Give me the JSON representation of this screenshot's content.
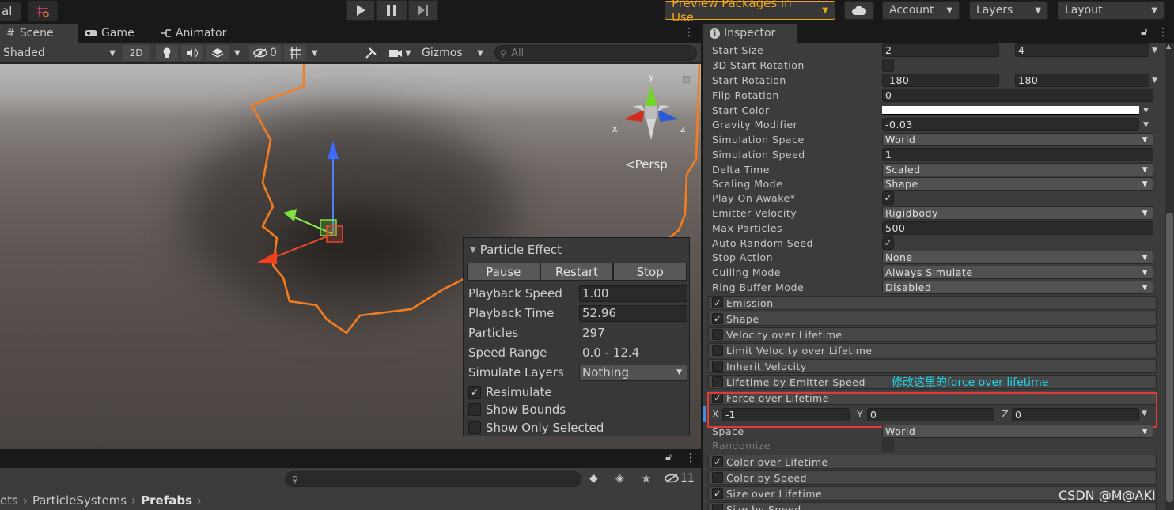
{
  "toolbar": {
    "left_label": "al",
    "preview_packages": "Preview Packages in Use",
    "account": "Account",
    "layers": "Layers",
    "layout": "Layout"
  },
  "scene_tabs": [
    {
      "label": "Scene",
      "icon": "grid-icon"
    },
    {
      "label": "Game",
      "icon": "gamepad-icon"
    },
    {
      "label": "Animator",
      "icon": "animator-icon"
    }
  ],
  "scene_bar": {
    "shading": "Shaded",
    "mode2d": "2D",
    "hidden_count": "0",
    "gizmos": "Gizmos",
    "search_placeholder": "All"
  },
  "gizmo": {
    "x": "x",
    "y": "y",
    "z": "z",
    "persp": "Persp"
  },
  "particle_effect": {
    "title": "Particle Effect",
    "buttons": [
      "Pause",
      "Restart",
      "Stop"
    ],
    "playback_speed_label": "Playback Speed",
    "playback_speed": "1.00",
    "playback_time_label": "Playback Time",
    "playback_time": "52.96",
    "particles_label": "Particles",
    "particles": "297",
    "speed_range_label": "Speed Range",
    "speed_range": "0.0 - 12.4",
    "simulate_layers_label": "Simulate Layers",
    "simulate_layers": "Nothing",
    "resimulate": "Resimulate",
    "show_bounds": "Show Bounds",
    "show_only_selected": "Show Only Selected"
  },
  "bottom": {
    "count": "11",
    "breadcrumb": [
      "ets",
      "ParticleSystems",
      "Prefabs"
    ]
  },
  "inspector": {
    "title": "Inspector",
    "rows": [
      {
        "label": "Start Size",
        "type": "range",
        "v1": "2",
        "v2": "4"
      },
      {
        "label": "3D Start Rotation",
        "type": "check",
        "checked": false
      },
      {
        "label": "Start Rotation",
        "type": "range",
        "v1": "-180",
        "v2": "180"
      },
      {
        "label": "Flip Rotation",
        "type": "field",
        "value": "0"
      },
      {
        "label": "Start Color",
        "type": "color"
      },
      {
        "label": "Gravity Modifier",
        "type": "fieldarrow",
        "value": "-0.03"
      },
      {
        "label": "Simulation Space",
        "type": "dropdown",
        "value": "World"
      },
      {
        "label": "Simulation Speed",
        "type": "field",
        "value": "1"
      },
      {
        "label": "Delta Time",
        "type": "dropdown",
        "value": "Scaled"
      },
      {
        "label": "Scaling Mode",
        "type": "dropdown",
        "value": "Shape"
      },
      {
        "label": "Play On Awake*",
        "type": "check",
        "checked": true
      },
      {
        "label": "Emitter Velocity",
        "type": "dropdown",
        "value": "Rigidbody"
      },
      {
        "label": "Max Particles",
        "type": "field",
        "value": "500"
      },
      {
        "label": "Auto Random Seed",
        "type": "check",
        "checked": true
      },
      {
        "label": "Stop Action",
        "type": "dropdown",
        "value": "None"
      },
      {
        "label": "Culling Mode",
        "type": "dropdown",
        "value": "Always Simulate"
      },
      {
        "label": "Ring Buffer Mode",
        "type": "dropdown",
        "value": "Disabled"
      }
    ],
    "modules_top": [
      {
        "label": "Emission",
        "checked": true
      },
      {
        "label": "Shape",
        "checked": true
      },
      {
        "label": "Velocity over Lifetime",
        "checked": false
      },
      {
        "label": "Limit Velocity over Lifetime",
        "checked": false
      },
      {
        "label": "Inherit Velocity",
        "checked": false
      },
      {
        "label": "Lifetime by Emitter Speed",
        "checked": false
      },
      {
        "label": "Force over Lifetime",
        "checked": true
      }
    ],
    "annotation": "修改这里的force over lifetime",
    "force": {
      "x_label": "X",
      "x": "-1",
      "y_label": "Y",
      "y": "0",
      "z_label": "Z",
      "z": "0"
    },
    "space_label": "Space",
    "space": "World",
    "randomize_label": "Randomize",
    "modules_bottom": [
      {
        "label": "Color over Lifetime",
        "checked": true
      },
      {
        "label": "Color by Speed",
        "checked": false
      },
      {
        "label": "Size over Lifetime",
        "checked": true
      },
      {
        "label": "Size by Speed",
        "checked": false
      }
    ]
  },
  "watermark": "CSDN @M@AKI",
  "colors": {
    "accent_orange": "#f57c1f",
    "highlight_red": "#e53935",
    "annotation_cyan": "#1fd6e8",
    "preview_text": "#f0a71a"
  }
}
